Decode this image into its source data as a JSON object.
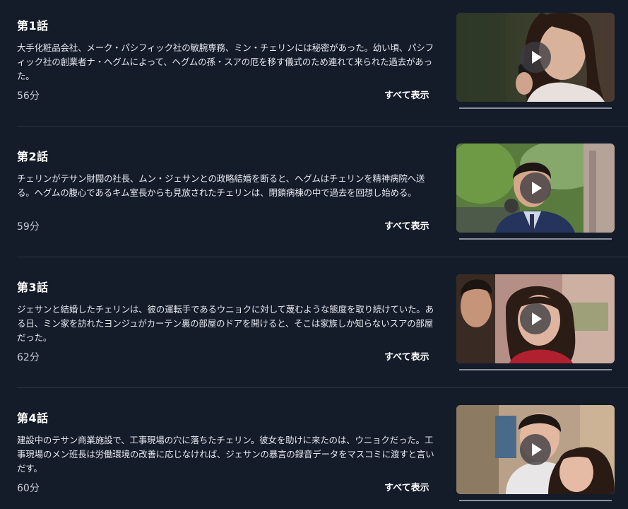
{
  "episodes": [
    {
      "title": "第1話",
      "description": "大手化粧品会社、メーク・パシフィック社の敏腕専務、ミン・チェリンには秘密があった。幼い頃、パシフィック社の創業者ナ・ヘグムによって、ヘグムの孫・スアの厄を移す儀式のため連れて来られた過去があった。",
      "duration": "56分",
      "show_all_label": "すべて表示",
      "thumbnail_icon": "play-icon",
      "progress": 0
    },
    {
      "title": "第2話",
      "description": "チェリンがテサン財閥の社長、ムン・ジェサンとの政略結婚を断ると、ヘグムはチェリンを精神病院へ送る。ヘグムの腹心であるキム室長からも見放されたチェリンは、閉鎖病棟の中で過去を回想し始める。",
      "duration": "59分",
      "show_all_label": "すべて表示",
      "thumbnail_icon": "play-icon",
      "progress": 0
    },
    {
      "title": "第3話",
      "description": "ジェサンと結婚したチェリンは、彼の運転手であるウニョクに対して蔑むような態度を取り続けていた。ある日、ミン家を訪れたヨンジュがカーテン裏の部屋のドアを開けると、そこは家族しか知らないスアの部屋だった。",
      "duration": "62分",
      "show_all_label": "すべて表示",
      "thumbnail_icon": "play-icon",
      "progress": 0
    },
    {
      "title": "第4話",
      "description": "建設中のテサン商業施設で、工事現場の穴に落ちたチェリン。彼女を助けに来たのは、ウニョクだった。工事現場のメン班長は労働環境の改善に応じなければ、ジェサンの暴言の録音データをマスコミに渡すと言いだす。",
      "duration": "60分",
      "show_all_label": "すべて表示",
      "thumbnail_icon": "play-icon",
      "progress": 0
    }
  ],
  "colors": {
    "background": "#141b29",
    "divider": "#2c3444",
    "progress_track": "#8b929c",
    "text_primary": "#ffffff",
    "text_secondary": "#c9ced6"
  }
}
